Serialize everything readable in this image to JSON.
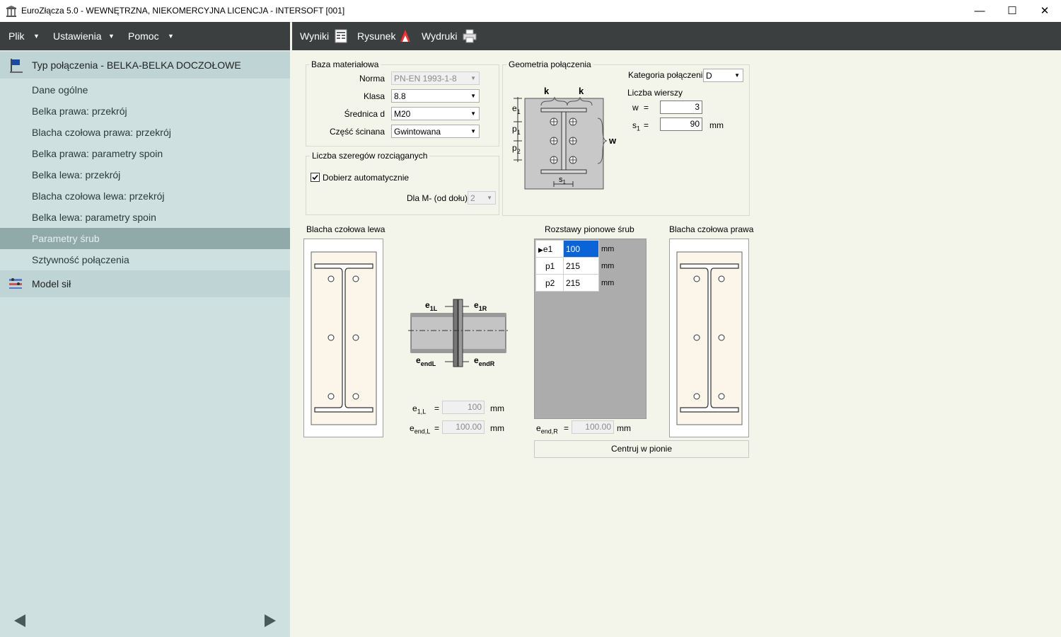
{
  "window": {
    "title": "EuroZłącza 5.0 - WEWNĘTRZNA, NIEKOMERCYJNA LICENCJA - INTERSOFT [001]",
    "minimize": "—",
    "maximize": "☐",
    "close": "✕"
  },
  "menu": {
    "items": [
      "Plik",
      "Ustawienia",
      "Pomoc"
    ]
  },
  "toolbar": {
    "results": "Wyniki",
    "drawing": "Rysunek",
    "prints": "Wydruki"
  },
  "sidebar": {
    "section1": "Typ połączenia - BELKA-BELKA DOCZOŁOWE",
    "items": [
      "Dane ogólne",
      "Belka prawa: przekrój",
      "Blacha czołowa prawa: przekrój",
      "Belka prawa: parametry spoin",
      "Belka lewa: przekrój",
      "Blacha czołowa lewa: przekrój",
      "Belka lewa: parametry spoin",
      "Parametry śrub",
      "Sztywność połączenia"
    ],
    "selected_index": 7,
    "section2": "Model sił"
  },
  "material": {
    "title": "Baza materiałowa",
    "norma_label": "Norma",
    "norma_value": "PN-EN 1993-1-8",
    "klasa_label": "Klasa",
    "klasa_value": "8.8",
    "srednica_label": "Średnica d",
    "srednica_value": "M20",
    "czesc_label": "Część ścinana",
    "czesc_value": "Gwintowana"
  },
  "rows_group": {
    "title": "Liczba szeregów rozciąganych",
    "auto_label": "Dobierz automatycznie",
    "auto_checked": true,
    "dlam_label": "Dla M- (od dołu):",
    "dlam_value": "2"
  },
  "geometry": {
    "title": "Geometria połączenia",
    "kategoria_label": "Kategoria połączenia",
    "kategoria_value": "D",
    "liczba_wierszy_label": "Liczba  wierszy",
    "w_label": "w",
    "w_value": "3",
    "s1_label": "s",
    "s1_sub": "1",
    "s1_value": "90",
    "unit": "mm",
    "eq": "="
  },
  "diagram": {
    "k": "k",
    "w": "w",
    "e": "e",
    "p": "p",
    "s": "s",
    "sub1": "1",
    "sub2": "2",
    "e1L": "1L",
    "e1R": "1R",
    "endL": "endL",
    "endR": "endR"
  },
  "left_plate": {
    "title": "Blacha czołowa lewa"
  },
  "right_plate": {
    "title": "Blacha czołowa prawa"
  },
  "spacing": {
    "title": "Rozstawy pionowe śrub",
    "rows": [
      {
        "name": "e1",
        "value": "100",
        "unit": "mm"
      },
      {
        "name": "p1",
        "value": "215",
        "unit": "mm"
      },
      {
        "name": "p2",
        "value": "215",
        "unit": "mm"
      }
    ],
    "center_button": "Centruj w pionie"
  },
  "offsets": {
    "e1L_label_main": "e",
    "e1L_label_sub": "1,L",
    "e1L_value": "100",
    "endL_label_main": "e",
    "endL_label_sub": "end,L",
    "endL_value": "100.00",
    "endR_label_main": "e",
    "endR_label_sub": "end,R",
    "endR_value": "100.00",
    "unit": "mm",
    "eq": "="
  }
}
